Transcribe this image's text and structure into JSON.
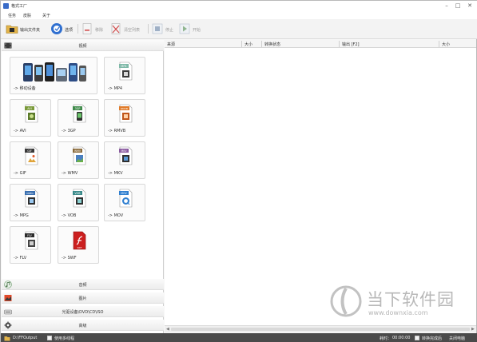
{
  "window": {
    "title": "格式工厂",
    "controls": {
      "minimize": "–",
      "maximize": "□",
      "close": "✕"
    }
  },
  "menu": {
    "items": [
      "任务",
      "皮肤",
      "关于"
    ]
  },
  "toolbar": {
    "output_folder": "输出文件夹",
    "options": "选项",
    "remove": "移除",
    "clear_list": "清空列表",
    "stop": "停止",
    "start": "开始"
  },
  "left_panel": {
    "video_category": "视频",
    "tiles": {
      "mobile": "-> 移动设备",
      "mp4": "-> MP4",
      "avi": "-> AVI",
      "3gp": "-> 3GP",
      "rmvb": "-> RMVB",
      "gif": "-> GIF",
      "wmv": "-> WMV",
      "mkv": "-> MKV",
      "mpg": "-> MPG",
      "vob": "-> VOB",
      "mov": "-> MOV",
      "flv": "-> FLV",
      "swf": "-> SWF"
    },
    "icon_badges": {
      "mp4": "MP4",
      "avi": "AVI",
      "3gp": "3GP",
      "rmvb": "RMVB",
      "gif": "GIF",
      "wmv": "WMV",
      "mkv": "MKV",
      "mpg": "MPEG",
      "vob": "VOB",
      "mov": "MOV",
      "flv": "FLV",
      "swf": "SWF"
    },
    "categories": {
      "audio": "音频",
      "image": "图片",
      "disc": "光驱设备\\DVD\\CD\\ISO",
      "advanced": "高级"
    }
  },
  "task_list": {
    "columns": [
      "来源",
      "大小",
      "转换状态",
      "输出 [F2]",
      "大小"
    ]
  },
  "status_bar": {
    "output_path": "D:\\FFOutput",
    "multithread_label": "使用多线程",
    "elapsed_label": "耗时：",
    "elapsed_value": "00:00:00",
    "after_convert_label": "转换完成后",
    "after_convert_action": "关闭电脑"
  },
  "watermark": {
    "text": "当下软件园",
    "url": "www.downxia.com"
  },
  "colors": {
    "status_bar": "#4a4a4a",
    "toolbar": "#f3f3f3",
    "accent_blue": "#2f6fd0",
    "swf_red": "#cc1f1f",
    "watermark": "#b8b8b8"
  }
}
